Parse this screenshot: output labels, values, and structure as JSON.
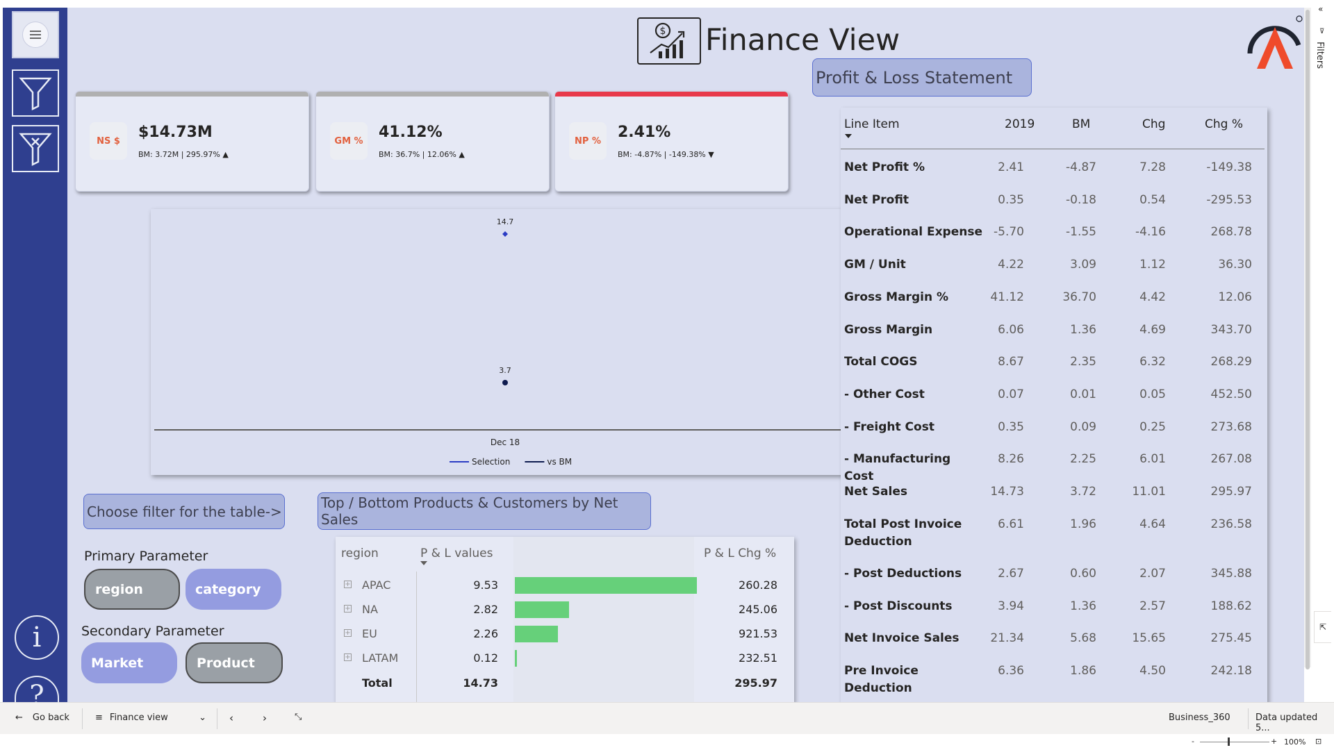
{
  "header": {
    "title": "Finance View",
    "logo_color_primary": "#ef4b2b",
    "logo_color_dark": "#1f2430"
  },
  "sidebar": {
    "items": [
      {
        "name": "menu",
        "icon": "hamburger-icon"
      },
      {
        "name": "filter",
        "icon": "filter-icon"
      },
      {
        "name": "clear-filter",
        "icon": "clear-filter-icon"
      }
    ],
    "info_glyph": "i",
    "help_glyph": "?"
  },
  "kpis": [
    {
      "badge": "NS $",
      "value": "$14.73M",
      "sub": "BM: 3.72M | 295.97%",
      "trend": "▲",
      "bar_color": "#b0b0b0"
    },
    {
      "badge": "GM %",
      "value": "41.12%",
      "sub": "BM: 36.7% | 12.06%",
      "trend": "▲",
      "bar_color": "#b0b0b0"
    },
    {
      "badge": "NP %",
      "value": "2.41%",
      "sub": "BM: -4.87% | -149.38%",
      "trend": "▼",
      "bar_color": "#e8394a"
    }
  ],
  "chart_data": {
    "type": "line",
    "x": [
      "Dec 18"
    ],
    "series": [
      {
        "name": "Selection",
        "values": [
          14.7
        ],
        "color": "#2b3cc4",
        "marker": "diamond"
      },
      {
        "name": "vs BM",
        "values": [
          3.7
        ],
        "color": "#0e1b4f",
        "marker": "circle"
      }
    ],
    "data_labels": [
      "14.7",
      "3.7"
    ],
    "ylim": [
      3.7,
      14.7
    ],
    "legend": "bottom",
    "grid": false
  },
  "filter_section": {
    "heading": "Choose filter for the table->",
    "primary_label": "Primary Parameter",
    "primary_options": [
      {
        "label": "region",
        "selected": false
      },
      {
        "label": "category",
        "selected": true
      }
    ],
    "secondary_label": "Secondary Parameter",
    "secondary_options": [
      {
        "label": "Market",
        "selected": true
      },
      {
        "label": "Product",
        "selected": false
      }
    ]
  },
  "top_bottom": {
    "heading": "Top / Bottom Products & Customers by Net Sales",
    "columns": [
      "region",
      "P & L values",
      "P & L Chg %"
    ],
    "bar_color": "#66d07a",
    "rows": [
      {
        "label": "APAC",
        "value": "9.53",
        "num": 9.53,
        "chg": "260.28"
      },
      {
        "label": "NA",
        "value": "2.82",
        "num": 2.82,
        "chg": "245.06"
      },
      {
        "label": "EU",
        "value": "2.26",
        "num": 2.26,
        "chg": "921.53"
      },
      {
        "label": "LATAM",
        "value": "0.12",
        "num": 0.12,
        "chg": "232.51"
      }
    ],
    "total": {
      "label": "Total",
      "value": "14.73",
      "chg": "295.97"
    }
  },
  "pl": {
    "heading": "Profit & Loss Statement",
    "columns": [
      "Line Item",
      "2019",
      "BM",
      "Chg",
      "Chg %"
    ],
    "rows": [
      {
        "label": "Net Profit %",
        "y2019": "2.41",
        "bm": "-4.87",
        "chg": "7.28",
        "chgpct": "-149.38"
      },
      {
        "label": "Net Profit",
        "y2019": "0.35",
        "bm": "-0.18",
        "chg": "0.54",
        "chgpct": "-295.53"
      },
      {
        "label": "Operational Expense",
        "y2019": "-5.70",
        "bm": "-1.55",
        "chg": "-4.16",
        "chgpct": "268.78"
      },
      {
        "label": "GM / Unit",
        "y2019": "4.22",
        "bm": "3.09",
        "chg": "1.12",
        "chgpct": "36.30"
      },
      {
        "label": "Gross Margin %",
        "y2019": "41.12",
        "bm": "36.70",
        "chg": "4.42",
        "chgpct": "12.06"
      },
      {
        "label": "Gross Margin",
        "y2019": "6.06",
        "bm": "1.36",
        "chg": "4.69",
        "chgpct": "343.70"
      },
      {
        "label": "Total COGS",
        "y2019": "8.67",
        "bm": "2.35",
        "chg": "6.32",
        "chgpct": "268.29"
      },
      {
        "label": "- Other Cost",
        "y2019": "0.07",
        "bm": "0.01",
        "chg": "0.05",
        "chgpct": "452.50"
      },
      {
        "label": "- Freight Cost",
        "y2019": "0.35",
        "bm": "0.09",
        "chg": "0.25",
        "chgpct": "273.68"
      },
      {
        "label": "- Manufacturing Cost",
        "y2019": "8.26",
        "bm": "2.25",
        "chg": "6.01",
        "chgpct": "267.08"
      },
      {
        "label": "Net Sales",
        "y2019": "14.73",
        "bm": "3.72",
        "chg": "11.01",
        "chgpct": "295.97"
      },
      {
        "label": "Total Post Invoice Deduction",
        "y2019": "6.61",
        "bm": "1.96",
        "chg": "4.64",
        "chgpct": "236.58"
      },
      {
        "label": "- Post Deductions",
        "y2019": "2.67",
        "bm": "0.60",
        "chg": "2.07",
        "chgpct": "345.88"
      },
      {
        "label": "- Post Discounts",
        "y2019": "3.94",
        "bm": "1.36",
        "chg": "2.57",
        "chgpct": "188.62"
      },
      {
        "label": "Net Invoice Sales",
        "y2019": "21.34",
        "bm": "5.68",
        "chg": "15.65",
        "chgpct": "275.45"
      },
      {
        "label": "Pre Invoice Deduction",
        "y2019": "6.36",
        "bm": "1.86",
        "chg": "4.50",
        "chgpct": "242.18"
      }
    ]
  },
  "bottom_bar": {
    "go_back": "Go back",
    "page_name": "Finance view",
    "workspace": "Business_360",
    "data_updated": "Data updated 5..."
  },
  "status": {
    "zoom": "100%",
    "zoom_minus": "-",
    "zoom_plus": "+"
  },
  "right_rail": {
    "filters_label": "Filters"
  }
}
